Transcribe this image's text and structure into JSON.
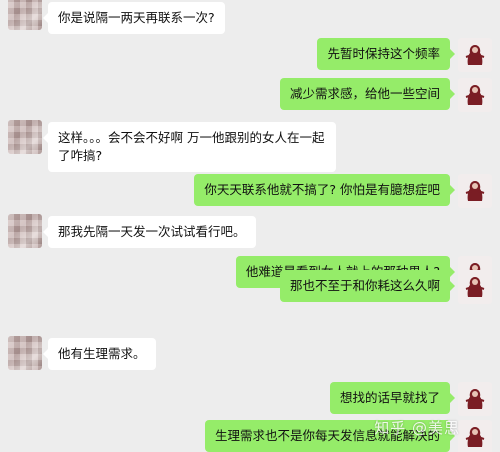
{
  "messages": [
    {
      "side": "left",
      "text": "你是说隔一两天再联系一次?"
    },
    {
      "side": "right",
      "text": "先暂时保持这个频率"
    },
    {
      "side": "right",
      "text": "减少需求感，给他一些空间"
    },
    {
      "side": "left",
      "text": "这样。。。会不会不好啊 万一他跟别的女人在一起了咋搞?"
    },
    {
      "side": "right",
      "text": "你天天联系他就不搞了? 你怕是有臆想症吧"
    },
    {
      "side": "left",
      "text": "那我先隔一天发一次试试看行吧。"
    },
    {
      "side": "right",
      "text": "他难道是看到女人就上的那种男人?"
    },
    {
      "side": "right",
      "text": "那也不至于和你耗这么久啊"
    },
    {
      "side": "left",
      "text": "他有生理需求。"
    },
    {
      "side": "right",
      "text": "想找的话早就找了"
    },
    {
      "side": "right",
      "text": "生理需求也不是你每天发信息就能解决的"
    }
  ],
  "watermark": "知乎 @美思",
  "colors": {
    "background": "#ededed",
    "bubble_left": "#ffffff",
    "bubble_right": "#95ec69"
  },
  "icons": {
    "left_avatar": "blurred-avatar-icon",
    "right_avatar": "profile-photo-icon"
  }
}
